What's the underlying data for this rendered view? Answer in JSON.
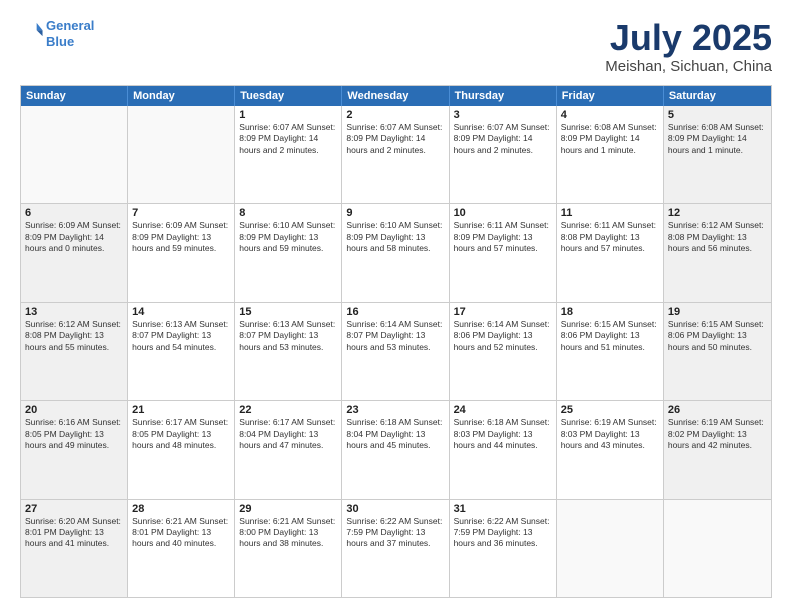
{
  "header": {
    "logo_line1": "General",
    "logo_line2": "Blue",
    "title": "July 2025",
    "subtitle": "Meishan, Sichuan, China"
  },
  "weekdays": [
    "Sunday",
    "Monday",
    "Tuesday",
    "Wednesday",
    "Thursday",
    "Friday",
    "Saturday"
  ],
  "weeks": [
    [
      {
        "day": "",
        "info": "",
        "empty": true
      },
      {
        "day": "",
        "info": "",
        "empty": true
      },
      {
        "day": "1",
        "info": "Sunrise: 6:07 AM\nSunset: 8:09 PM\nDaylight: 14 hours\nand 2 minutes."
      },
      {
        "day": "2",
        "info": "Sunrise: 6:07 AM\nSunset: 8:09 PM\nDaylight: 14 hours\nand 2 minutes."
      },
      {
        "day": "3",
        "info": "Sunrise: 6:07 AM\nSunset: 8:09 PM\nDaylight: 14 hours\nand 2 minutes."
      },
      {
        "day": "4",
        "info": "Sunrise: 6:08 AM\nSunset: 8:09 PM\nDaylight: 14 hours\nand 1 minute."
      },
      {
        "day": "5",
        "info": "Sunrise: 6:08 AM\nSunset: 8:09 PM\nDaylight: 14 hours\nand 1 minute."
      }
    ],
    [
      {
        "day": "6",
        "info": "Sunrise: 6:09 AM\nSunset: 8:09 PM\nDaylight: 14 hours\nand 0 minutes."
      },
      {
        "day": "7",
        "info": "Sunrise: 6:09 AM\nSunset: 8:09 PM\nDaylight: 13 hours\nand 59 minutes."
      },
      {
        "day": "8",
        "info": "Sunrise: 6:10 AM\nSunset: 8:09 PM\nDaylight: 13 hours\nand 59 minutes."
      },
      {
        "day": "9",
        "info": "Sunrise: 6:10 AM\nSunset: 8:09 PM\nDaylight: 13 hours\nand 58 minutes."
      },
      {
        "day": "10",
        "info": "Sunrise: 6:11 AM\nSunset: 8:09 PM\nDaylight: 13 hours\nand 57 minutes."
      },
      {
        "day": "11",
        "info": "Sunrise: 6:11 AM\nSunset: 8:08 PM\nDaylight: 13 hours\nand 57 minutes."
      },
      {
        "day": "12",
        "info": "Sunrise: 6:12 AM\nSunset: 8:08 PM\nDaylight: 13 hours\nand 56 minutes."
      }
    ],
    [
      {
        "day": "13",
        "info": "Sunrise: 6:12 AM\nSunset: 8:08 PM\nDaylight: 13 hours\nand 55 minutes."
      },
      {
        "day": "14",
        "info": "Sunrise: 6:13 AM\nSunset: 8:07 PM\nDaylight: 13 hours\nand 54 minutes."
      },
      {
        "day": "15",
        "info": "Sunrise: 6:13 AM\nSunset: 8:07 PM\nDaylight: 13 hours\nand 53 minutes."
      },
      {
        "day": "16",
        "info": "Sunrise: 6:14 AM\nSunset: 8:07 PM\nDaylight: 13 hours\nand 53 minutes."
      },
      {
        "day": "17",
        "info": "Sunrise: 6:14 AM\nSunset: 8:06 PM\nDaylight: 13 hours\nand 52 minutes."
      },
      {
        "day": "18",
        "info": "Sunrise: 6:15 AM\nSunset: 8:06 PM\nDaylight: 13 hours\nand 51 minutes."
      },
      {
        "day": "19",
        "info": "Sunrise: 6:15 AM\nSunset: 8:06 PM\nDaylight: 13 hours\nand 50 minutes."
      }
    ],
    [
      {
        "day": "20",
        "info": "Sunrise: 6:16 AM\nSunset: 8:05 PM\nDaylight: 13 hours\nand 49 minutes."
      },
      {
        "day": "21",
        "info": "Sunrise: 6:17 AM\nSunset: 8:05 PM\nDaylight: 13 hours\nand 48 minutes."
      },
      {
        "day": "22",
        "info": "Sunrise: 6:17 AM\nSunset: 8:04 PM\nDaylight: 13 hours\nand 47 minutes."
      },
      {
        "day": "23",
        "info": "Sunrise: 6:18 AM\nSunset: 8:04 PM\nDaylight: 13 hours\nand 45 minutes."
      },
      {
        "day": "24",
        "info": "Sunrise: 6:18 AM\nSunset: 8:03 PM\nDaylight: 13 hours\nand 44 minutes."
      },
      {
        "day": "25",
        "info": "Sunrise: 6:19 AM\nSunset: 8:03 PM\nDaylight: 13 hours\nand 43 minutes."
      },
      {
        "day": "26",
        "info": "Sunrise: 6:19 AM\nSunset: 8:02 PM\nDaylight: 13 hours\nand 42 minutes."
      }
    ],
    [
      {
        "day": "27",
        "info": "Sunrise: 6:20 AM\nSunset: 8:01 PM\nDaylight: 13 hours\nand 41 minutes."
      },
      {
        "day": "28",
        "info": "Sunrise: 6:21 AM\nSunset: 8:01 PM\nDaylight: 13 hours\nand 40 minutes."
      },
      {
        "day": "29",
        "info": "Sunrise: 6:21 AM\nSunset: 8:00 PM\nDaylight: 13 hours\nand 38 minutes."
      },
      {
        "day": "30",
        "info": "Sunrise: 6:22 AM\nSunset: 7:59 PM\nDaylight: 13 hours\nand 37 minutes."
      },
      {
        "day": "31",
        "info": "Sunrise: 6:22 AM\nSunset: 7:59 PM\nDaylight: 13 hours\nand 36 minutes."
      },
      {
        "day": "",
        "info": "",
        "empty": true
      },
      {
        "day": "",
        "info": "",
        "empty": true
      }
    ]
  ]
}
